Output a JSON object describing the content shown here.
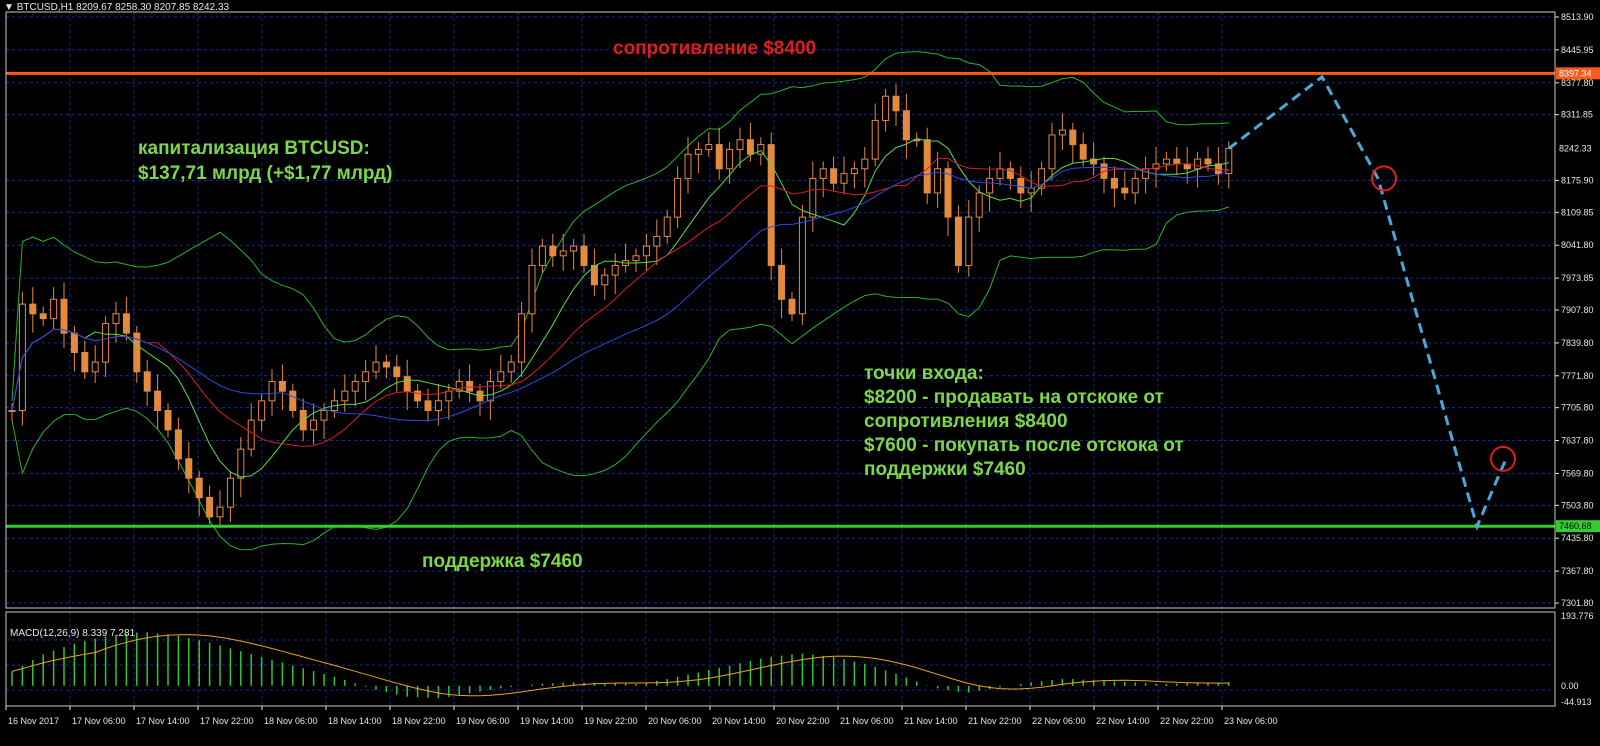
{
  "header": {
    "dropdown_icon": "triangle-down-icon",
    "symbol": "BTCUSD,H1",
    "ohlc": "8209.67 8258.30 8207.85 8242.33"
  },
  "macd_header": "MACD(12,26,9) 8.339 7.281",
  "annotations": {
    "resistance": "сопротивление $8400",
    "cap_line1": "капитализация BTCUSD:",
    "cap_line2": "$137,71 млрд (+$1,77 млрд)",
    "support": "поддержка $7460",
    "entry_title": "точки входа:",
    "entry_line1": "$8200 - продавать на отскоке от",
    "entry_line2": "сопротивления $8400",
    "entry_line3": "$7600 - покупать после отскока от",
    "entry_line4": "поддержки $7460"
  },
  "colors": {
    "background": "#000000",
    "grid": "#1a2a8a",
    "up_candle": "#000000",
    "candle_outline": "#e38a3e",
    "resistance_line": "#ff5a1a",
    "support_line": "#33cc33",
    "bollinger": "#28b428",
    "ma_fast": "#5adc46",
    "ma_mid": "#dc1e1e",
    "ma_slow": "#2a4ae8",
    "forecast": "#4aa8d8",
    "target_circle": "#e01e1e",
    "resistance_text": "#dd1f1f",
    "green_text": "#7cd84a",
    "macd_hist": "#2ec82e",
    "macd_signal": "#f0a020",
    "axis_text": "#e8e8e8"
  },
  "chart_data": {
    "type": "candlestick",
    "symbol": "BTCUSD",
    "timeframe": "H1",
    "x_labels": [
      "16 Nov 2017",
      "17 Nov 06:00",
      "17 Nov 14:00",
      "17 Nov 22:00",
      "18 Nov 06:00",
      "18 Nov 14:00",
      "18 Nov 22:00",
      "19 Nov 06:00",
      "19 Nov 14:00",
      "19 Nov 22:00",
      "20 Nov 06:00",
      "20 Nov 14:00",
      "20 Nov 22:00",
      "21 Nov 06:00",
      "21 Nov 14:00",
      "21 Nov 22:00",
      "22 Nov 06:00",
      "22 Nov 14:00",
      "22 Nov 22:00",
      "23 Nov 06:00"
    ],
    "y_ticks": [
      "8513.90",
      "8445.95",
      "8377.80",
      "8311.85",
      "8175.90",
      "8109.85",
      "8041.80",
      "7973.85",
      "7907.80",
      "7839.80",
      "7771.80",
      "7705.80",
      "7637.80",
      "7569.80",
      "7503.80",
      "7435.80",
      "7367.80",
      "7301.80"
    ],
    "ylim": [
      7301.8,
      8513.9
    ],
    "last_price": "8242.33",
    "resistance_level": "8397.34",
    "support_level": "7460.68",
    "approx_close_path": [
      [
        0,
        7700
      ],
      [
        1,
        7920
      ],
      [
        2,
        7900
      ],
      [
        3,
        7890
      ],
      [
        4,
        7930
      ],
      [
        5,
        7860
      ],
      [
        6,
        7820
      ],
      [
        7,
        7780
      ],
      [
        8,
        7800
      ],
      [
        9,
        7880
      ],
      [
        10,
        7900
      ],
      [
        11,
        7860
      ],
      [
        12,
        7780
      ],
      [
        13,
        7740
      ],
      [
        14,
        7700
      ],
      [
        15,
        7660
      ],
      [
        16,
        7600
      ],
      [
        17,
        7560
      ],
      [
        18,
        7520
      ],
      [
        19,
        7480
      ],
      [
        20,
        7500
      ],
      [
        21,
        7560
      ],
      [
        22,
        7620
      ],
      [
        23,
        7680
      ],
      [
        24,
        7720
      ],
      [
        25,
        7760
      ],
      [
        26,
        7740
      ],
      [
        27,
        7700
      ],
      [
        28,
        7660
      ],
      [
        29,
        7680
      ],
      [
        30,
        7700
      ],
      [
        31,
        7720
      ],
      [
        32,
        7740
      ],
      [
        33,
        7760
      ],
      [
        34,
        7780
      ],
      [
        35,
        7800
      ],
      [
        36,
        7790
      ],
      [
        37,
        7770
      ],
      [
        38,
        7740
      ],
      [
        39,
        7720
      ],
      [
        40,
        7700
      ],
      [
        41,
        7720
      ],
      [
        42,
        7740
      ],
      [
        43,
        7760
      ],
      [
        44,
        7740
      ],
      [
        45,
        7720
      ],
      [
        46,
        7760
      ],
      [
        47,
        7780
      ],
      [
        48,
        7800
      ],
      [
        49,
        7900
      ],
      [
        50,
        8000
      ],
      [
        51,
        8040
      ],
      [
        52,
        8020
      ],
      [
        53,
        8030
      ],
      [
        54,
        8040
      ],
      [
        55,
        8000
      ],
      [
        56,
        7960
      ],
      [
        57,
        7980
      ],
      [
        58,
        8000
      ],
      [
        59,
        8010
      ],
      [
        60,
        8020
      ],
      [
        61,
        8040
      ],
      [
        62,
        8060
      ],
      [
        63,
        8100
      ],
      [
        64,
        8180
      ],
      [
        65,
        8230
      ],
      [
        66,
        8240
      ],
      [
        67,
        8250
      ],
      [
        68,
        8200
      ],
      [
        69,
        8240
      ],
      [
        70,
        8260
      ],
      [
        71,
        8230
      ],
      [
        72,
        8250
      ],
      [
        73,
        8000
      ],
      [
        74,
        7930
      ],
      [
        75,
        7900
      ],
      [
        76,
        8100
      ],
      [
        77,
        8180
      ],
      [
        78,
        8200
      ],
      [
        79,
        8170
      ],
      [
        80,
        8190
      ],
      [
        81,
        8200
      ],
      [
        82,
        8220
      ],
      [
        83,
        8300
      ],
      [
        84,
        8350
      ],
      [
        85,
        8320
      ],
      [
        86,
        8260
      ],
      [
        87,
        8260
      ],
      [
        88,
        8150
      ],
      [
        89,
        8200
      ],
      [
        90,
        8100
      ],
      [
        91,
        8000
      ],
      [
        92,
        8100
      ],
      [
        93,
        8150
      ],
      [
        94,
        8180
      ],
      [
        95,
        8200
      ],
      [
        96,
        8180
      ],
      [
        97,
        8150
      ],
      [
        98,
        8160
      ],
      [
        99,
        8200
      ],
      [
        100,
        8270
      ],
      [
        101,
        8280
      ],
      [
        102,
        8250
      ],
      [
        103,
        8220
      ],
      [
        104,
        8210
      ],
      [
        105,
        8180
      ],
      [
        106,
        8160
      ],
      [
        107,
        8150
      ],
      [
        108,
        8180
      ],
      [
        109,
        8200
      ],
      [
        110,
        8210
      ],
      [
        111,
        8220
      ],
      [
        112,
        8210
      ],
      [
        113,
        8200
      ],
      [
        114,
        8220
      ],
      [
        115,
        8210
      ],
      [
        116,
        8190
      ],
      [
        117,
        8242
      ]
    ],
    "forecast_path": [
      [
        8242,
        0
      ],
      [
        8390,
        1
      ],
      [
        8180,
        2
      ],
      [
        7460,
        3
      ],
      [
        7600,
        4
      ]
    ],
    "macd": {
      "ylim": [
        -44.913,
        193.776
      ],
      "y_ticks": [
        "193.776",
        "0.00",
        "-44.913"
      ],
      "histogram_shape": [
        40,
        90,
        120,
        140,
        150,
        140,
        120,
        95,
        70,
        45,
        20,
        -10,
        -30,
        -35,
        -20,
        -5,
        5,
        10,
        8,
        5,
        20,
        40,
        60,
        80,
        90,
        80,
        60,
        30,
        -5,
        -20,
        -5,
        10,
        20,
        15,
        10,
        5,
        8,
        10
      ]
    }
  }
}
